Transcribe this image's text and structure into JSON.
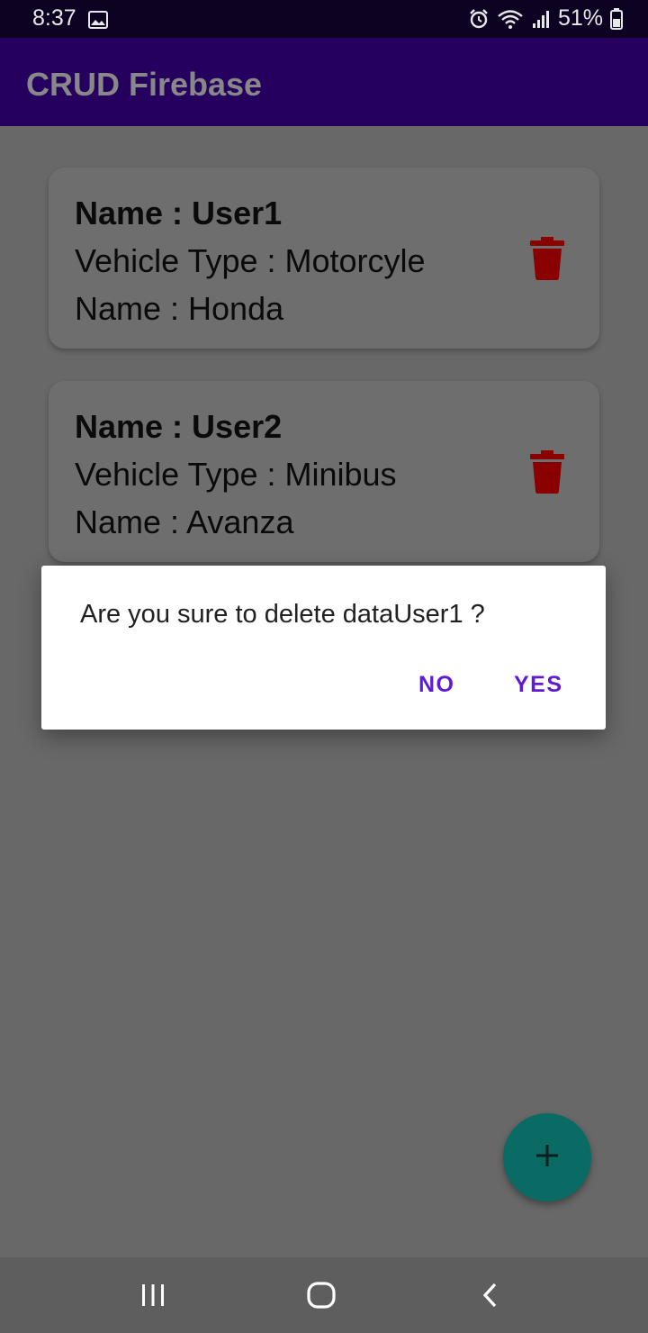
{
  "status_bar": {
    "time": "8:37",
    "battery": "51%",
    "icons": [
      "gallery-icon",
      "alarm-icon",
      "wifi-icon",
      "signal-icon",
      "battery-icon"
    ]
  },
  "app_bar": {
    "title": "CRUD Firebase"
  },
  "cards": [
    {
      "name": "Name : User1",
      "vehicle_type": "Vehicle Type : Motorcyle",
      "vehicle_name": "Name : Honda"
    },
    {
      "name": "Name : User2",
      "vehicle_type": "Vehicle Type : Minibus",
      "vehicle_name": "Name : Avanza"
    }
  ],
  "dialog": {
    "message": "Are you sure to delete dataUser1 ?",
    "no_label": "NO",
    "yes_label": "YES"
  },
  "colors": {
    "app_bar": "#26005f",
    "trash": "#8a0000",
    "fab": "#0a6a64",
    "dialog_button": "#5f1ad4"
  }
}
